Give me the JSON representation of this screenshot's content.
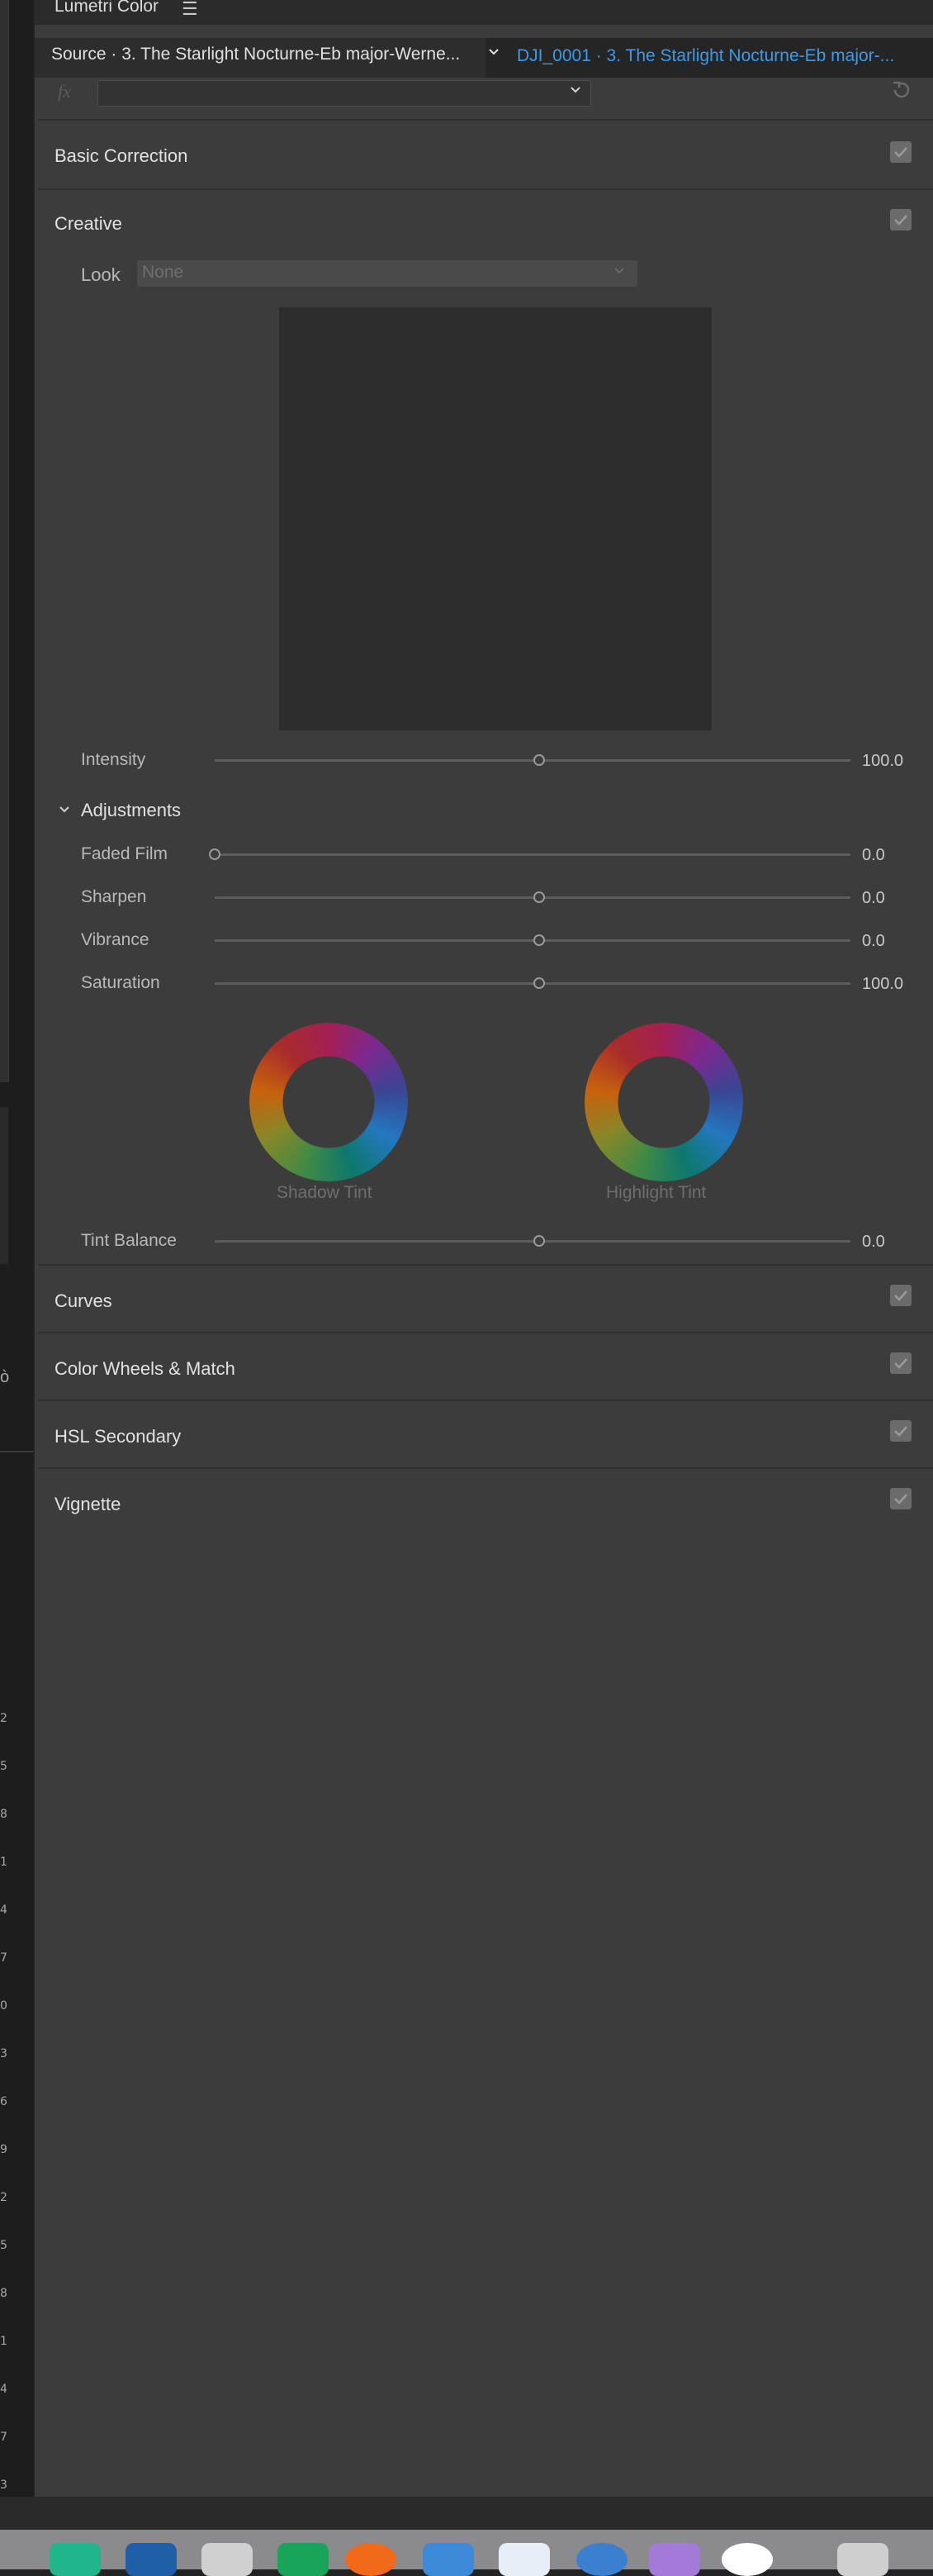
{
  "panel": {
    "title": "Lumetri Color",
    "source_label": "Source · 3. The Starlight Nocturne-Eb major-Werne...",
    "clip_label": "DJI_0001 · 3. The Starlight Nocturne-Eb major-...",
    "fx_label": "fx"
  },
  "sections": {
    "basic_correction": "Basic Correction",
    "creative": "Creative",
    "curves": "Curves",
    "color_wheels": "Color Wheels & Match",
    "hsl_secondary": "HSL Secondary",
    "vignette": "Vignette"
  },
  "creative": {
    "look_label": "Look",
    "look_value": "None",
    "intensity": {
      "label": "Intensity",
      "value": "100.0",
      "fraction": 0.51
    },
    "adjustments_label": "Adjustments",
    "faded_film": {
      "label": "Faded Film",
      "value": "0.0",
      "fraction": 0.0
    },
    "sharpen": {
      "label": "Sharpen",
      "value": "0.0",
      "fraction": 0.51
    },
    "vibrance": {
      "label": "Vibrance",
      "value": "0.0",
      "fraction": 0.51
    },
    "saturation": {
      "label": "Saturation",
      "value": "100.0",
      "fraction": 0.51
    },
    "shadow_tint_label": "Shadow Tint",
    "highlight_tint_label": "Highlight Tint",
    "tint_balance": {
      "label": "Tint Balance",
      "value": "0.0",
      "fraction": 0.51
    }
  },
  "left_numbers": [
    "2",
    "5",
    "8",
    "1",
    "4",
    "7",
    "0",
    "3",
    "6",
    "9",
    "2",
    "5",
    "8",
    "1",
    "4",
    "7",
    "3"
  ],
  "colors": {
    "accent": "#3e9ae6",
    "panel_bg": "#3c3c3c",
    "header_bg": "#2b2b2b"
  },
  "icons": {
    "menu": "hamburger-icon",
    "reset": "reset-icon",
    "checkbox": "checkmark-icon"
  }
}
